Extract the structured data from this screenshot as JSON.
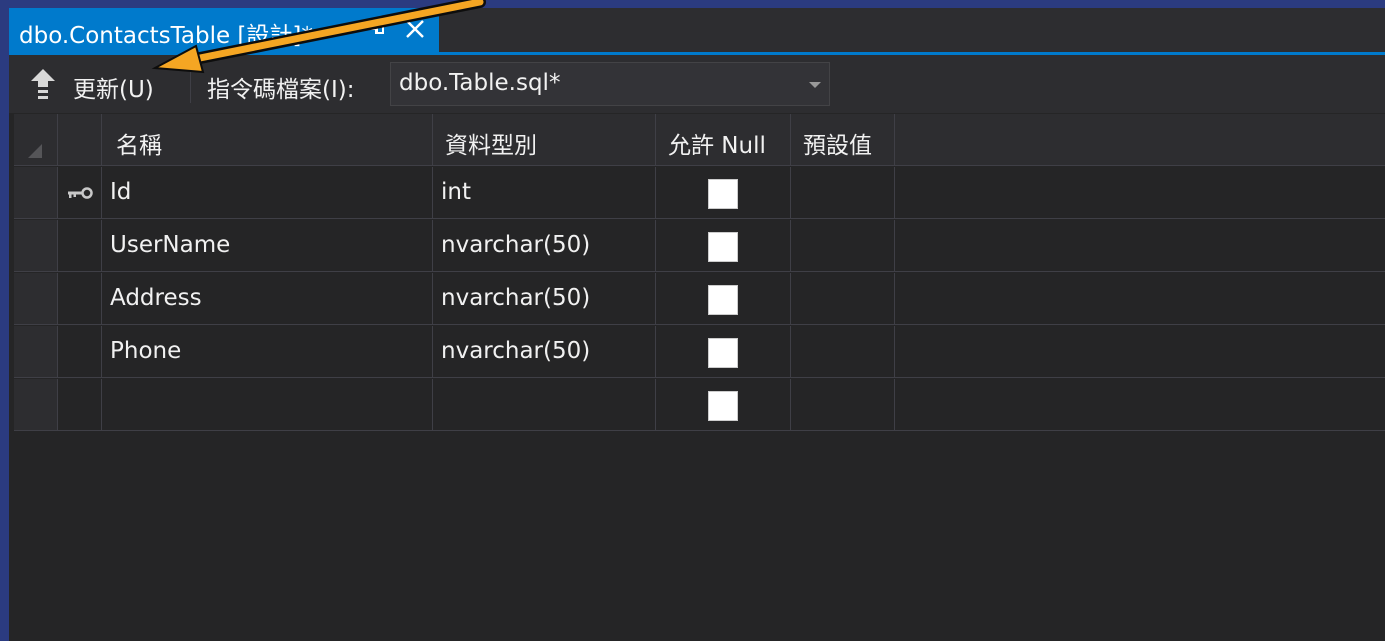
{
  "tab": {
    "title": "dbo.ContactsTable [設計]*"
  },
  "toolbar": {
    "update_label": "更新(U)",
    "script_file_label": "指令碼檔案(I):",
    "script_file_value": "dbo.Table.sql*"
  },
  "grid": {
    "headers": {
      "name": "名稱",
      "data_type": "資料型別",
      "allow_null": "允許 Null",
      "default": "預設值"
    },
    "rows": [
      {
        "name": "Id",
        "data_type": "int",
        "allow_null": false,
        "default": "",
        "primary_key": true
      },
      {
        "name": "UserName",
        "data_type": "nvarchar(50)",
        "allow_null": false,
        "default": "",
        "primary_key": false
      },
      {
        "name": "Address",
        "data_type": "nvarchar(50)",
        "allow_null": false,
        "default": "",
        "primary_key": false
      },
      {
        "name": "Phone",
        "data_type": "nvarchar(50)",
        "allow_null": false,
        "default": "",
        "primary_key": false
      },
      {
        "name": "",
        "data_type": "",
        "allow_null": false,
        "default": "",
        "primary_key": false
      }
    ]
  },
  "icons": {
    "tab_pin": "pin-icon",
    "tab_close": "close-icon",
    "update": "upload-arrow-icon",
    "dropdown": "chevron-down-icon",
    "primary_key": "key-icon",
    "annotation": "annotation-arrow-icon"
  },
  "colors": {
    "accent": "#007acc",
    "background": "#252526",
    "annotation_arrow": "#f5a623"
  }
}
